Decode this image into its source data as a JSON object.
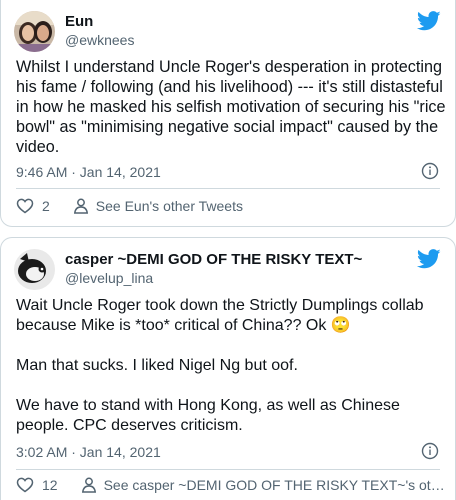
{
  "tweets": [
    {
      "name": "Eun",
      "handle": "@ewknees",
      "text": "Whilst I understand Uncle Roger's desperation in protecting his fame / following (and his livelihood) --- it's still distasteful in how he masked his selfish motivation of securing his \"rice bowl\" as \"minimising negative social impact\" caused by the video.",
      "timestamp": "9:46 AM · Jan 14, 2021",
      "likes": "2",
      "other_link": "See Eun's other Tweets",
      "icons": {
        "like": "heart-icon",
        "profile": "person-icon",
        "info": "info-icon",
        "brand": "twitter-bird-icon"
      }
    },
    {
      "name": "casper ~DEMI GOD OF THE RISKY TEXT~",
      "handle": "@levelup_lina",
      "paragraphs": [
        "Wait Uncle Roger took down the Strictly Dumplings collab because Mike is *too* critical of China?? Ok 🙄",
        "Man that sucks. I liked Nigel Ng but oof.",
        "We have to stand with Hong Kong, as well as Chinese people. CPC deserves criticism."
      ],
      "timestamp": "3:02 AM · Jan 14, 2021",
      "likes": "12",
      "other_link": "See casper ~DEMI GOD OF THE RISKY TEXT~'s other Twe...",
      "icons": {
        "like": "heart-icon",
        "profile": "person-icon",
        "info": "info-icon",
        "brand": "twitter-bird-icon"
      }
    }
  ],
  "colors": {
    "brand": "#1d9bf0",
    "secondary_text": "#536471",
    "border": "#cfd9de"
  }
}
